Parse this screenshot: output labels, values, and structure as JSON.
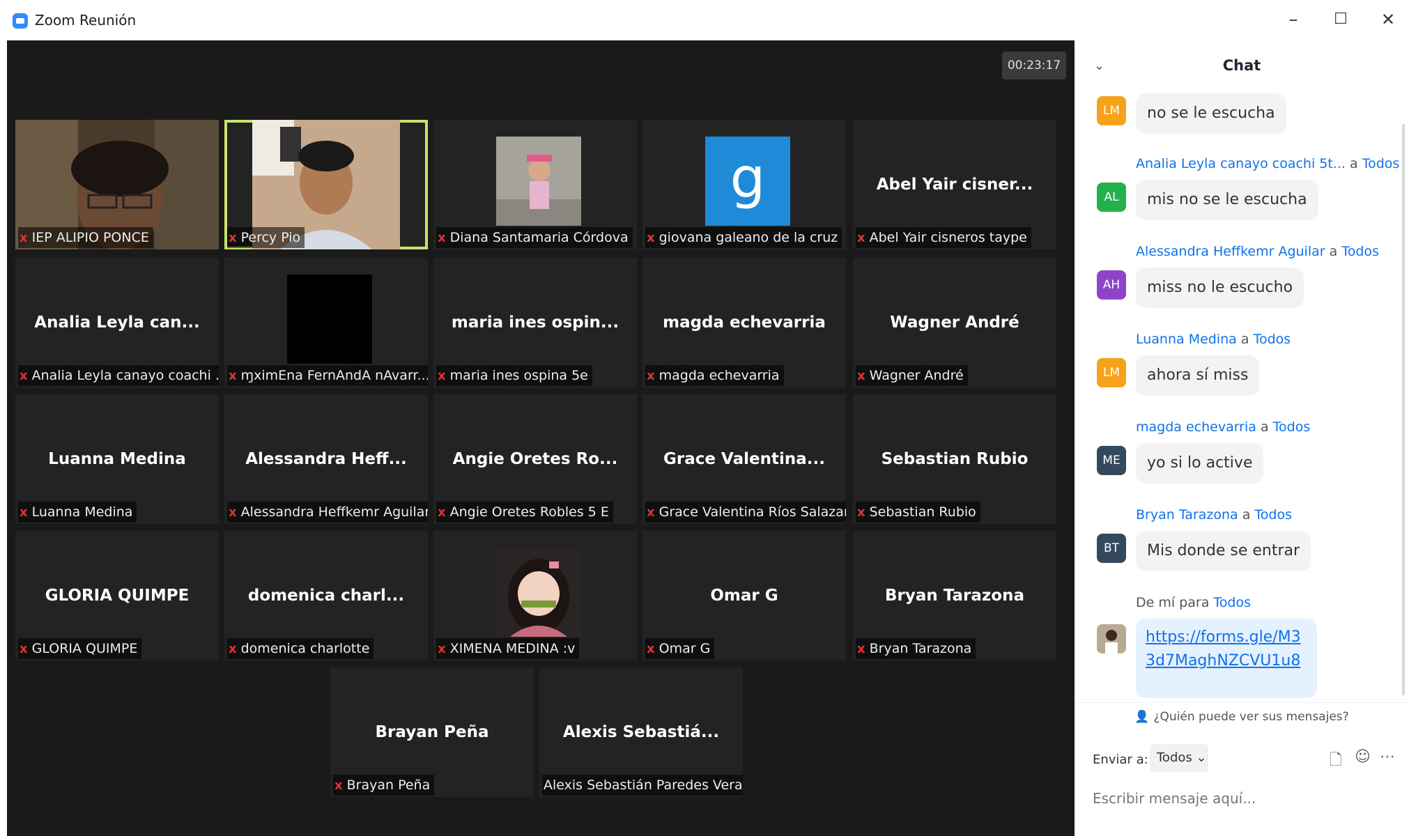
{
  "window": {
    "title": "Zoom Reunión",
    "minimize": "–",
    "maximize": "☐",
    "close": "✕"
  },
  "timer": "00:23:17",
  "tiles": [
    {
      "big": "",
      "label": "IEP ALIPIO PONCE"
    },
    {
      "big": "",
      "label": "Percy Pio"
    },
    {
      "big": "",
      "label": "Diana Santamaria Córdova"
    },
    {
      "big": "",
      "label": "giovana galeano de la cruz"
    },
    {
      "big": "Abel Yair cisner...",
      "label": "Abel Yair cisneros taype"
    },
    {
      "big": "Analia Leyla can...",
      "label": "Analia Leyla canayo coachi ..."
    },
    {
      "big": "",
      "label": "ɱximEna FernAndA nAvarr..."
    },
    {
      "big": "maria ines ospin...",
      "label": "maria ines ospina 5e"
    },
    {
      "big": "magda echevarria",
      "label": "magda echevarria"
    },
    {
      "big": "Wagner André",
      "label": "Wagner André"
    },
    {
      "big": "Luanna Medina",
      "label": "Luanna Medina"
    },
    {
      "big": "Alessandra Heff...",
      "label": "Alessandra Heffkemr Aguilar"
    },
    {
      "big": "Angie Oretes Ro...",
      "label": "Angie Oretes Robles 5 E"
    },
    {
      "big": "Grace Valentina...",
      "label": "Grace Valentina Ríos Salazar"
    },
    {
      "big": "Sebastian Rubio",
      "label": "Sebastian Rubio"
    },
    {
      "big": "GLORIA QUIMPE",
      "label": "GLORIA QUIMPE"
    },
    {
      "big": "domenica charl...",
      "label": "domenica charlotte"
    },
    {
      "big": "",
      "label": "XIMENA MEDINA :v"
    },
    {
      "big": "Omar G",
      "label": "Omar G"
    },
    {
      "big": "Bryan Tarazona",
      "label": "Bryan Tarazona"
    },
    {
      "big": "Brayan Peña",
      "label": "Brayan Peña"
    },
    {
      "big": "Alexis Sebastiá...",
      "label": "Alexis Sebastián Paredes Vera"
    }
  ],
  "giovana_initial": "g",
  "chat": {
    "title": "Chat",
    "to_word": "a",
    "messages": [
      {
        "sender": "",
        "to": "",
        "initials": "LM",
        "color": "#f7a21b",
        "text": "no se le escucha"
      },
      {
        "sender": "Analia Leyla canayo coachi 5t...",
        "to": "Todos",
        "initials": "AL",
        "color": "#23b14d",
        "text": "mis no se le escucha"
      },
      {
        "sender": "Alessandra Heffkemr Aguilar",
        "to": "Todos",
        "initials": "AH",
        "color": "#8e44c9",
        "text": "miss no le escucho"
      },
      {
        "sender": "Luanna Medina",
        "to": "Todos",
        "initials": "LM",
        "color": "#f7a21b",
        "text": "ahora sí miss"
      },
      {
        "sender": "magda echevarria",
        "to": "Todos",
        "initials": "ME",
        "color": "#34495e",
        "text": "yo si lo active"
      },
      {
        "sender": "Bryan Tarazona",
        "to": "Todos",
        "initials": "BT",
        "color": "#34495e",
        "text": "Mis donde se entrar"
      }
    ],
    "own": {
      "prefix": "De mí para",
      "to": "Todos",
      "link": "https://forms.gle/M33d7MaghNZCVU1u8"
    },
    "who_can_see": "¿Quién puede ver sus mensajes?",
    "send_to_label": "Enviar a:",
    "send_to_value": "Todos ⌄",
    "input_placeholder": "Escribir mensaje aquí..."
  }
}
